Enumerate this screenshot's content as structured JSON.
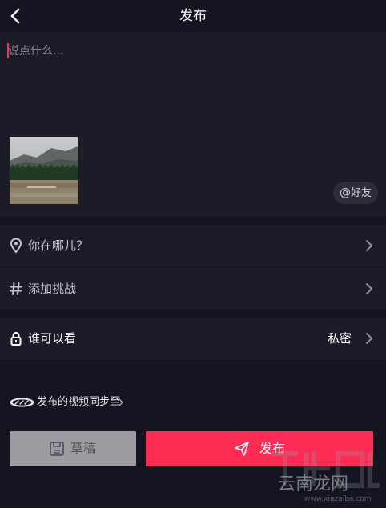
{
  "header": {
    "title": "发布",
    "back_icon": "chevron-left-icon"
  },
  "compose": {
    "placeholder": "说点什么...",
    "mention_at": "@",
    "mention_label": "好友",
    "caret_color": "#fe2c55"
  },
  "options": {
    "location": {
      "label": "你在哪儿？",
      "icon": "location-pin-icon"
    },
    "challenge": {
      "label": "添加挑战",
      "icon": "hashtag-icon"
    },
    "privacy": {
      "label": "谁可以看",
      "value": "私密",
      "icon": "lock-icon"
    }
  },
  "sync": {
    "label": "发布的视频同步至"
  },
  "actions": {
    "draft_label": "草稿",
    "publish_label": "发布"
  },
  "watermark": {
    "text": "云南龙网",
    "sub": "www.xiazaiba.com"
  },
  "colors": {
    "accent": "#fe2c55",
    "background": "#141520",
    "panel": "#1b1c27",
    "draft": "#9b9ca2"
  }
}
